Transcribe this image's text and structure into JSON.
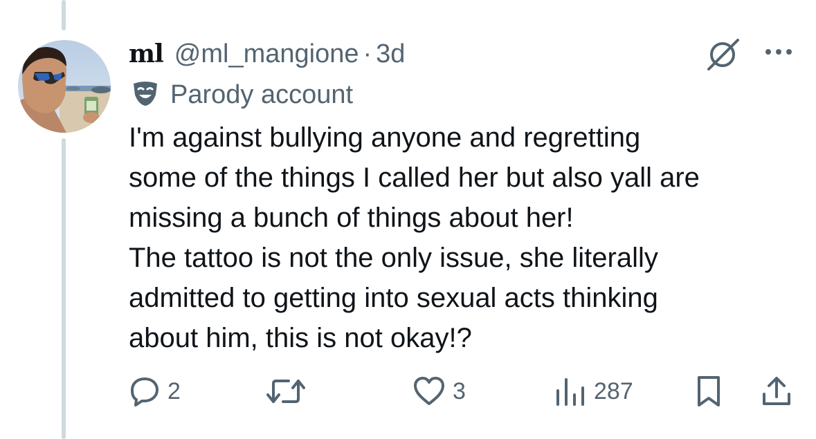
{
  "tweet": {
    "display_name": "ml",
    "handle": "@ml_mangione",
    "separator": "·",
    "timestamp": "3d",
    "label": "Parody account",
    "text_lines": [
      "I'm against bullying anyone and regretting",
      "some of the things I called her but also yall are",
      "missing a bunch of things about her!",
      "The tattoo is not the only issue, she literally",
      "admitted to getting into sexual acts thinking",
      "about him, this is not okay!?"
    ]
  },
  "actions": {
    "replies": "2",
    "reposts": "",
    "likes": "3",
    "views": "287"
  },
  "icons": {
    "header": [
      "grok-icon",
      "more-icon"
    ],
    "label": "parody-mask-icon",
    "actions": [
      "reply-icon",
      "repost-icon",
      "like-icon",
      "views-icon",
      "bookmark-icon",
      "share-icon"
    ]
  },
  "colors": {
    "text_primary": "#0f1419",
    "text_secondary": "#536471",
    "thread_line": "#cfd9de"
  }
}
